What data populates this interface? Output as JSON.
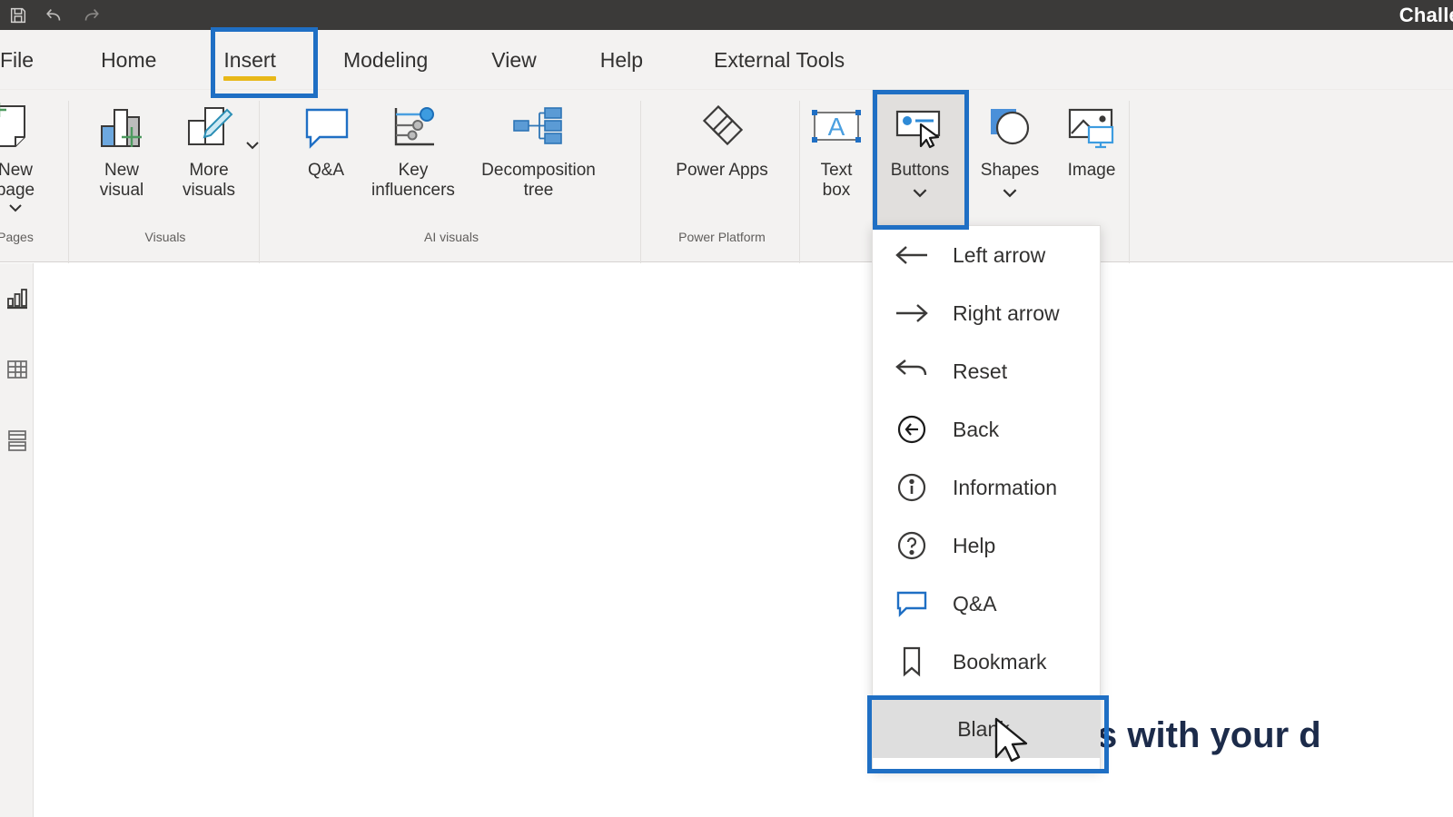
{
  "window": {
    "title_fragment": "Challe",
    "quick_access": [
      {
        "name": "save-icon",
        "label": "Save"
      },
      {
        "name": "undo-icon",
        "label": "Undo"
      },
      {
        "name": "redo-icon",
        "label": "Redo"
      }
    ]
  },
  "ribbon": {
    "tabs": [
      {
        "label": "File",
        "active": false
      },
      {
        "label": "Home",
        "active": false
      },
      {
        "label": "Insert",
        "active": true
      },
      {
        "label": "Modeling",
        "active": false
      },
      {
        "label": "View",
        "active": false
      },
      {
        "label": "Help",
        "active": false
      },
      {
        "label": "External Tools",
        "active": false
      }
    ],
    "groups": [
      {
        "label": "Pages",
        "items": [
          {
            "label": "New\npage",
            "icon": "new-page-icon",
            "chevron": true
          }
        ]
      },
      {
        "label": "Visuals",
        "items": [
          {
            "label": "New\nvisual",
            "icon": "new-visual-icon",
            "chevron": false
          },
          {
            "label": "More\nvisuals",
            "icon": "more-visuals-icon",
            "chevron": true
          }
        ]
      },
      {
        "label": "AI visuals",
        "items": [
          {
            "label": "Q&A",
            "icon": "qa-icon",
            "chevron": false
          },
          {
            "label": "Key\ninfluencers",
            "icon": "key-influencers-icon",
            "chevron": false
          },
          {
            "label": "Decomposition\ntree",
            "icon": "decomposition-tree-icon",
            "chevron": false
          }
        ]
      },
      {
        "label": "Power Platform",
        "items": [
          {
            "label": "Power Apps",
            "icon": "power-apps-icon",
            "chevron": false
          }
        ]
      },
      {
        "label": "",
        "items": [
          {
            "label": "Text\nbox",
            "icon": "text-box-icon",
            "chevron": false
          },
          {
            "label": "Buttons",
            "icon": "buttons-icon",
            "chevron": true,
            "selected": true
          },
          {
            "label": "Shapes",
            "icon": "shapes-icon",
            "chevron": true
          },
          {
            "label": "Image",
            "icon": "image-icon",
            "chevron": false
          }
        ]
      }
    ]
  },
  "rail": {
    "items": [
      {
        "name": "report-view-icon",
        "label": "Report view"
      },
      {
        "name": "data-view-icon",
        "label": "Data view"
      },
      {
        "name": "model-view-icon",
        "label": "Model view"
      }
    ]
  },
  "buttons_menu": {
    "items": [
      {
        "label": "Left arrow",
        "icon": "left-arrow-icon",
        "highlighted": false
      },
      {
        "label": "Right arrow",
        "icon": "right-arrow-icon",
        "highlighted": false
      },
      {
        "label": "Reset",
        "icon": "reset-icon",
        "highlighted": false
      },
      {
        "label": "Back",
        "icon": "back-circle-icon",
        "highlighted": false
      },
      {
        "label": "Information",
        "icon": "information-icon",
        "highlighted": false
      },
      {
        "label": "Help",
        "icon": "help-icon",
        "highlighted": false
      },
      {
        "label": "Q&A",
        "icon": "qa-bubble-icon",
        "highlighted": false
      },
      {
        "label": "Bookmark",
        "icon": "bookmark-icon",
        "highlighted": false
      },
      {
        "label": "Blank",
        "icon": "blank-icon",
        "highlighted": true
      }
    ]
  },
  "canvas": {
    "heading_fragment": "suals with your d"
  },
  "annotations": {
    "accent_color": "#1f6fc4",
    "tab_underline_color": "#e8b818",
    "boxes": [
      {
        "name": "insert-tab-highlight"
      },
      {
        "name": "buttons-button-highlight"
      },
      {
        "name": "blank-menu-item-highlight"
      }
    ]
  }
}
